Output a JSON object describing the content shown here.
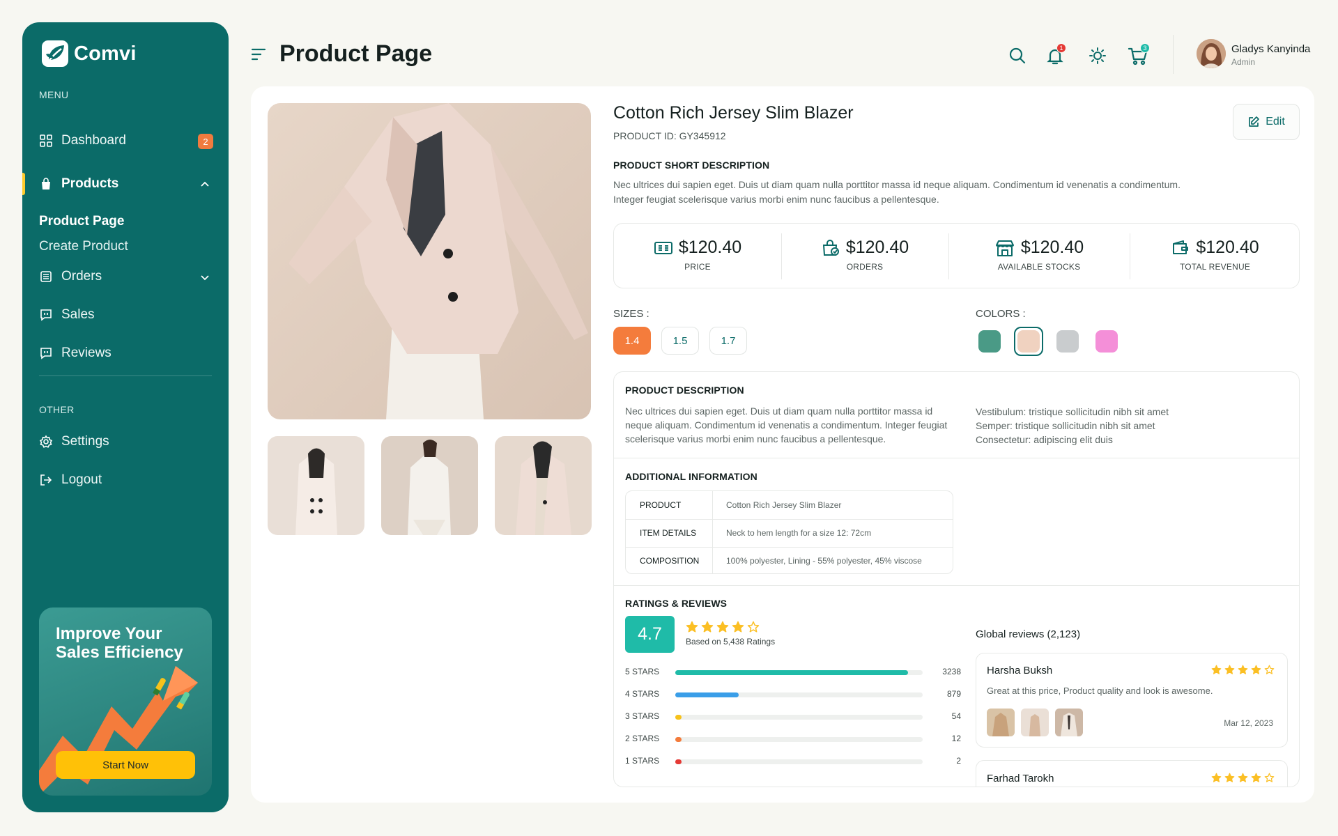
{
  "brand": {
    "name": "Comvi"
  },
  "sidebar": {
    "menu_label": "MENU",
    "dashboard": {
      "label": "Dashboard",
      "badge": "2"
    },
    "products": {
      "label": "Products",
      "sub": [
        "Product Page",
        "Create Product"
      ]
    },
    "orders": {
      "label": "Orders"
    },
    "sales": {
      "label": "Sales"
    },
    "reviews": {
      "label": "Reviews"
    },
    "other_label": "OTHER",
    "settings": {
      "label": "Settings"
    },
    "logout": {
      "label": "Logout"
    },
    "promo": {
      "title": "Improve Your Sales Efficiency",
      "button": "Start Now"
    }
  },
  "header": {
    "title": "Product Page",
    "notif_count": "1",
    "cart_count": "3",
    "user": {
      "name": "Gladys Kanyinda",
      "role": "Admin"
    }
  },
  "product": {
    "name": "Cotton Rich Jersey Slim Blazer",
    "id": "PRODUCT ID: GY345912",
    "edit_label": "Edit",
    "short_desc_title": "PRODUCT SHORT DESCRIPTION",
    "short_desc": [
      "Nec ultrices dui sapien eget. Duis ut diam quam nulla porttitor massa id neque aliquam. Condimentum id venenatis a condimentum.",
      "Integer feugiat scelerisque varius morbi enim nunc faucibus a pellentesque."
    ],
    "stats": [
      {
        "value": "$120.40",
        "label": "PRICE",
        "icon": "cash-icon"
      },
      {
        "value": "$120.40",
        "label": "ORDERS",
        "icon": "shopping-bag-icon"
      },
      {
        "value": "$120.40",
        "label": "AVAILABLE STOCKS",
        "icon": "store-icon"
      },
      {
        "value": "$120.40",
        "label": "TOTAL REVENUE",
        "icon": "wallet-icon"
      }
    ],
    "sizes_label": "SIZES :",
    "sizes": [
      "1.4",
      "1.5",
      "1.7"
    ],
    "selected_size": "1.4",
    "colors_label": "COLORS :",
    "colors": [
      "#4a9a86",
      "#f0d2c0",
      "#c9ccce",
      "#f48fd8"
    ],
    "selected_color": "#f0d2c0",
    "desc_title": "PRODUCT DESCRIPTION",
    "desc": [
      "Nec ultrices dui sapien eget. Duis ut diam quam nulla porttitor massa id",
      "neque aliquam. Condimentum id venenatis a condimentum. Integer feugiat",
      "scelerisque varius morbi enim nunc faucibus a pellentesque."
    ],
    "desc_points": [
      "Vestibulum: tristique sollicitudin nibh sit amet",
      "Semper: tristique sollicitudin nibh sit amet",
      "Consectetur: adipiscing elit duis"
    ],
    "additional_title": "ADDITIONAL INFORMATION",
    "additional": [
      {
        "key": "PRODUCT",
        "value": "Cotton Rich Jersey Slim Blazer"
      },
      {
        "key": "ITEM DETAILS",
        "value": "Neck to hem length for a size 12: 72cm"
      },
      {
        "key": "COMPOSITION",
        "value": "100% polyester, Lining - 55% polyester, 45% viscose"
      }
    ]
  },
  "ratings": {
    "title": "RATINGS & REVIEWS",
    "score": "4.7",
    "stars": 4.7,
    "based_on": "Based on 5,438 Ratings",
    "bars": [
      {
        "label": "5 STARS",
        "count": "3238",
        "color": "#1fbba8"
      },
      {
        "label": "4 STARS",
        "count": "879",
        "color": "#3a9ee8"
      },
      {
        "label": "3 STARS",
        "count": "54",
        "color": "#f7c21b"
      },
      {
        "label": "2 STARS",
        "count": "12",
        "color": "#f47c3c"
      },
      {
        "label": "1 STARS",
        "count": "2",
        "color": "#e53935"
      }
    ],
    "global_label": "Global reviews (2,123)",
    "reviews": [
      {
        "name": "Harsha Buksh",
        "text": "Great at this price, Product quality and look is awesome.",
        "date": "Mar 12, 2023",
        "stars": 4
      },
      {
        "name": "Farhad Tarokh",
        "stars": 4
      }
    ]
  }
}
